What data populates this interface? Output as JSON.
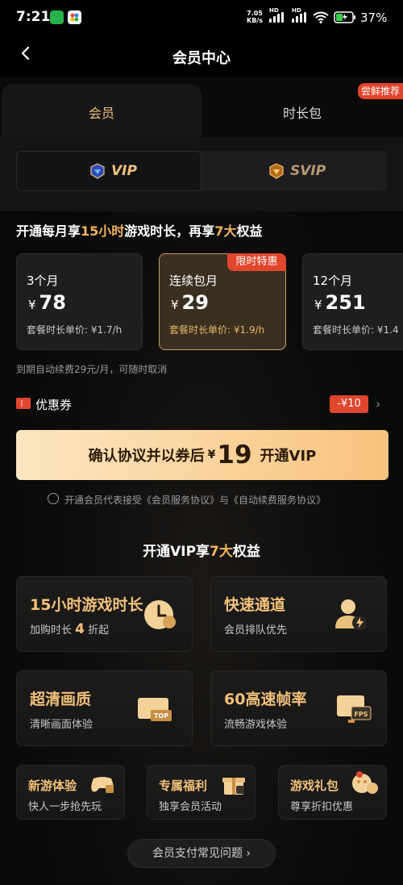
{
  "status_bar": {
    "time": "7:21",
    "net_speed": "7.05",
    "net_unit": "KB/s",
    "hd1": "HD",
    "hd2": "HD",
    "battery": "37%"
  },
  "header": {
    "title": "会员中心"
  },
  "tabs": {
    "member": "会员",
    "time_pack": "时长包",
    "badge": "尝鲜推荐"
  },
  "vip_switch": {
    "vip": "VIP",
    "svip": "SVIP"
  },
  "headline": {
    "part1": "开通每月享",
    "h1": "15小时",
    "part2": "游戏时长，再享",
    "h2": "7大",
    "part3": "权益"
  },
  "plans": [
    {
      "name": "3个月",
      "currency": "¥",
      "price": "78",
      "unit": "套餐时长单价: ¥1.7/h"
    },
    {
      "name": "连续包月",
      "currency": "¥",
      "price": "29",
      "unit": "套餐时长单价: ¥1.9/h",
      "badge": "限时特惠"
    },
    {
      "name": "12个月",
      "currency": "¥",
      "price": "251",
      "unit": "套餐时长单价: ¥1.4"
    }
  ],
  "renew_note": "到期自动续费29元/月，可随时取消",
  "coupon": {
    "label": "优惠券",
    "value": "-¥10"
  },
  "cta": {
    "prefix": "确认协议并以券后",
    "currency": "¥",
    "price": "19",
    "suffix": "开通VIP"
  },
  "agreement": "开通会员代表接受《会员服务协议》与《自动续费服务协议》",
  "benefits_title": {
    "part1": "开通VIP享",
    "h": "7大",
    "part2": "权益"
  },
  "benefits": [
    {
      "title": "15小时游戏时长",
      "sub_pre": "加购时长",
      "sub_num": "4",
      "sub_post": "折起",
      "icon": "clock-icon"
    },
    {
      "title": "快速通道",
      "sub": "会员排队优先",
      "icon": "user-lightning-icon"
    },
    {
      "title": "超清画质",
      "sub": "清晰画面体验",
      "icon": "top-screen-icon"
    },
    {
      "title": "60高速帧率",
      "sub": "流畅游戏体验",
      "icon": "fps-monitor-icon"
    },
    {
      "title": "新游体验",
      "sub": "快人一步抢先玩",
      "icon": "gamepad-icon"
    },
    {
      "title": "专属福利",
      "sub": "独享会员活动",
      "icon": "gift-icon"
    },
    {
      "title": "游戏礼包",
      "sub": "尊享折扣优惠",
      "icon": "coin-bag-icon"
    }
  ],
  "faq": "会员支付常见问题 ›",
  "colors": {
    "gold": "#f3b45a",
    "red_badge": "#e0452e",
    "cta_gradient_start": "#fbe7c2",
    "cta_gradient_end": "#f7c37e"
  }
}
